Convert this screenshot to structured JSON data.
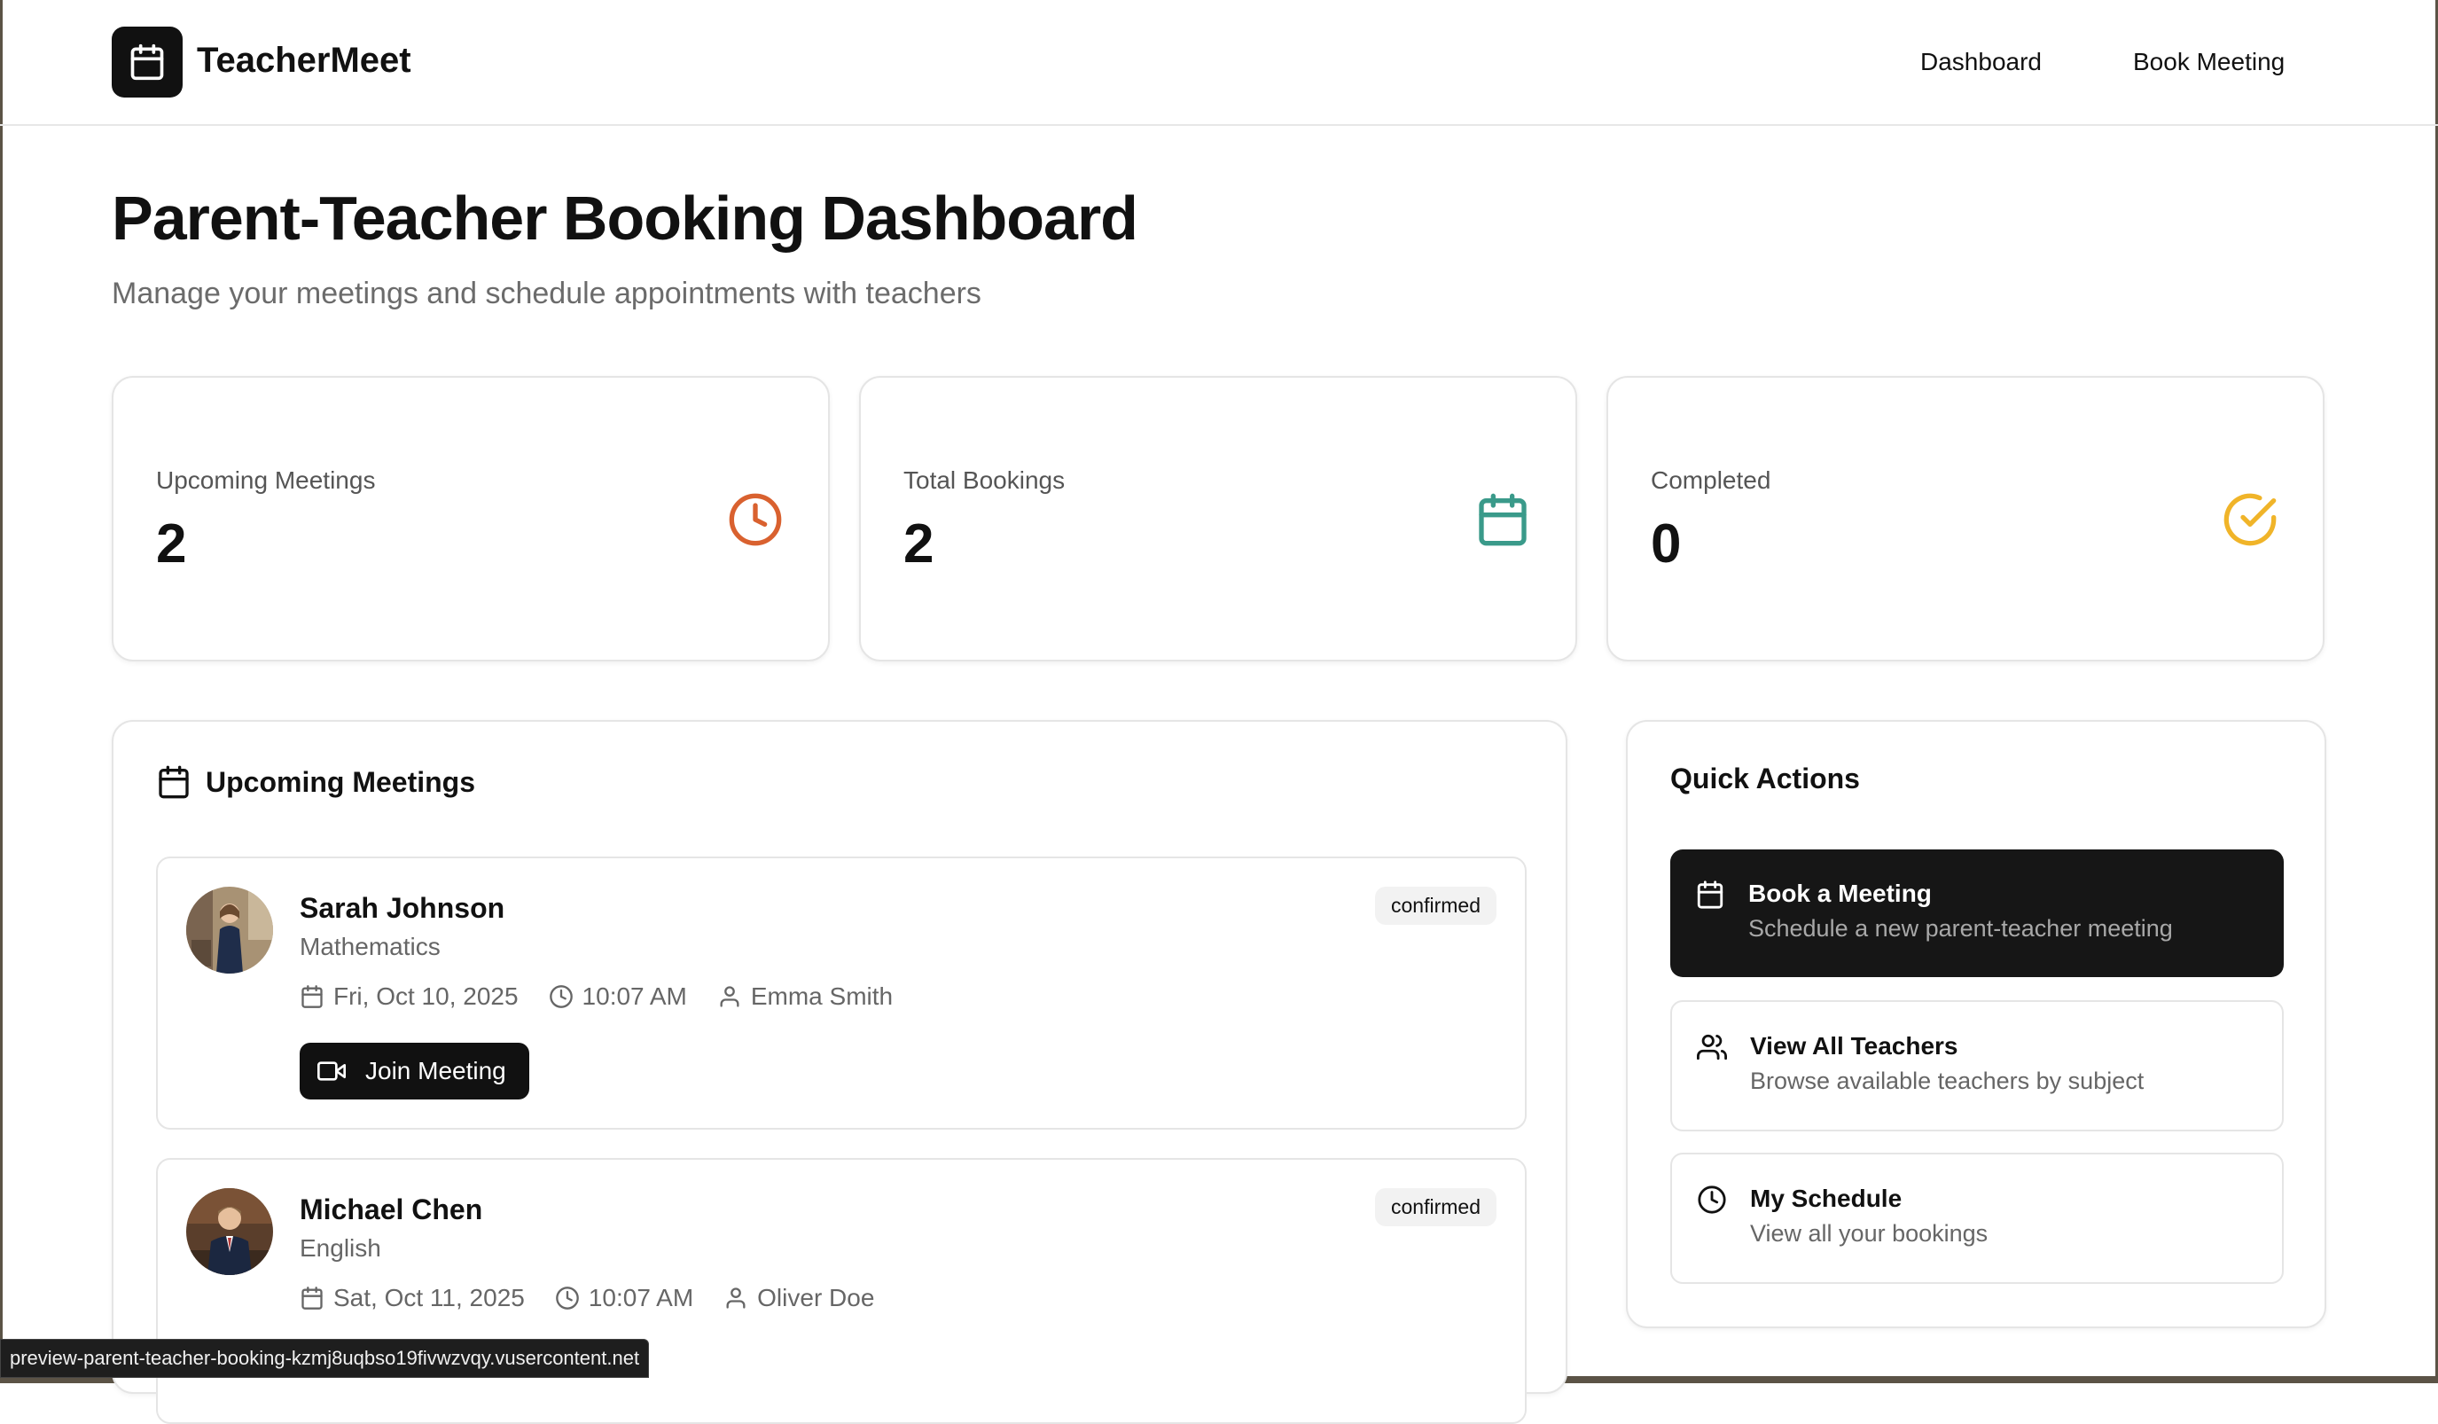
{
  "app": {
    "brand": "TeacherMeet"
  },
  "nav": {
    "items": [
      {
        "label": "Dashboard"
      },
      {
        "label": "Book Meeting"
      }
    ]
  },
  "page": {
    "title": "Parent-Teacher Booking Dashboard",
    "subtitle": "Manage your meetings and schedule appointments with teachers"
  },
  "stats": [
    {
      "label": "Upcoming Meetings",
      "value": "2",
      "icon": "clock-icon",
      "color": "#d9612f"
    },
    {
      "label": "Total Bookings",
      "value": "2",
      "icon": "calendar-icon",
      "color": "#3a9a8a"
    },
    {
      "label": "Completed",
      "value": "0",
      "icon": "check-circle-icon",
      "color": "#f0b429"
    }
  ],
  "meetings": {
    "title": "Upcoming Meetings",
    "items": [
      {
        "teacher": "Sarah Johnson",
        "subject": "Mathematics",
        "status": "confirmed",
        "date": "Fri, Oct 10, 2025",
        "time": "10:07 AM",
        "student": "Emma Smith",
        "join_label": "Join Meeting"
      },
      {
        "teacher": "Michael Chen",
        "subject": "English",
        "status": "confirmed",
        "date": "Sat, Oct 11, 2025",
        "time": "10:07 AM",
        "student": "Oliver Doe"
      }
    ]
  },
  "quick_actions": {
    "title": "Quick Actions",
    "items": [
      {
        "label": "Book a Meeting",
        "description": "Schedule a new parent-teacher meeting",
        "icon": "calendar-icon"
      },
      {
        "label": "View All Teachers",
        "description": "Browse available teachers by subject",
        "icon": "users-icon"
      },
      {
        "label": "My Schedule",
        "description": "View all your bookings",
        "icon": "clock-icon"
      }
    ]
  },
  "status_bar": {
    "url": "preview-parent-teacher-booking-kzmj8uqbso19fivwzvqy.vusercontent.net"
  }
}
